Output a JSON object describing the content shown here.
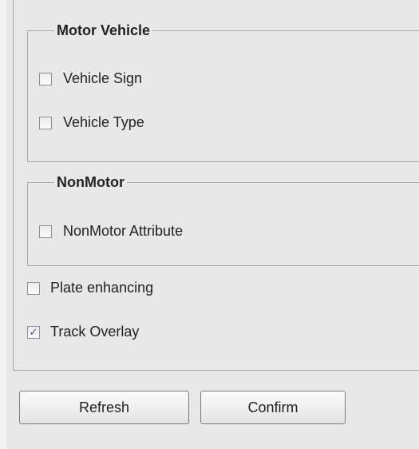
{
  "motor_vehicle": {
    "legend": "Motor Vehicle",
    "options": [
      {
        "label": "Vehicle Sign",
        "checked": false
      },
      {
        "label": "Vehicle Type",
        "checked": false
      }
    ]
  },
  "non_motor": {
    "legend": "NonMotor",
    "options": [
      {
        "label": "NonMotor Attribute",
        "checked": false
      }
    ]
  },
  "general": {
    "plate_enhancing": {
      "label": "Plate enhancing",
      "checked": false
    },
    "track_overlay": {
      "label": "Track Overlay",
      "checked": true
    }
  },
  "buttons": {
    "refresh_label": "Refresh",
    "confirm_label": "Confirm"
  },
  "check_glyph": "✓",
  "colors": {
    "panel_bg": "#e8e8e8",
    "border": "#a9a9a9",
    "check_color": "#2a4b9b"
  }
}
